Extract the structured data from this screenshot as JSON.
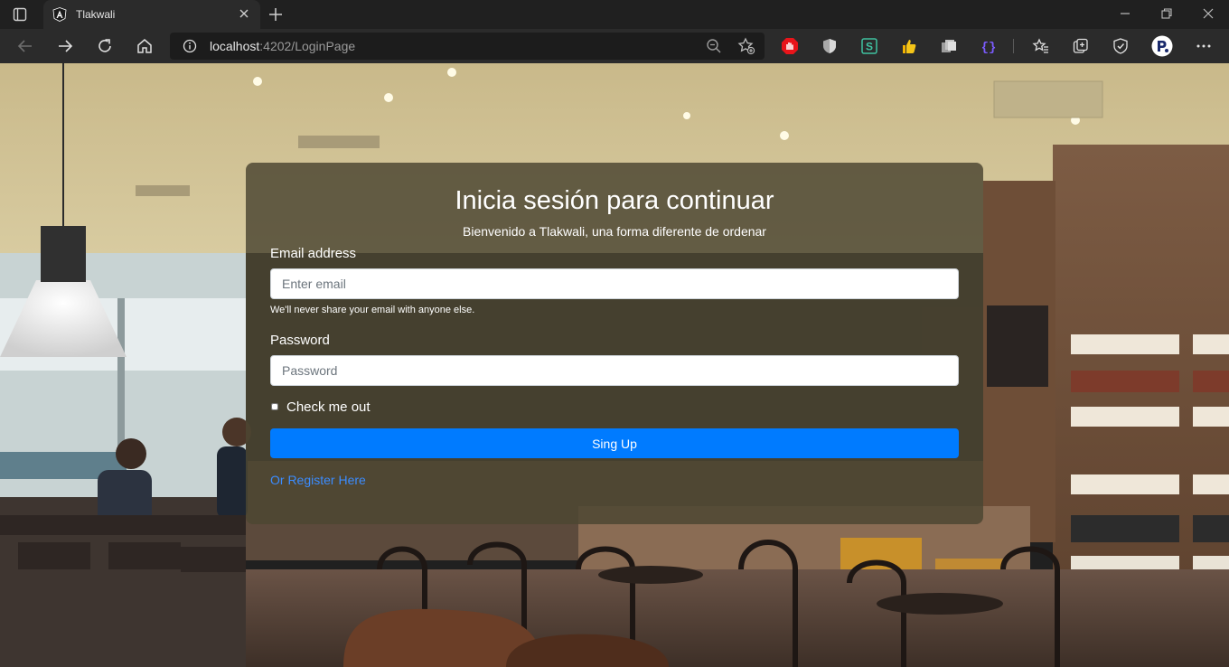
{
  "browser": {
    "tab": {
      "title": "Tlakwali",
      "favicon": "angular-icon"
    },
    "address_bar": {
      "host": "localhost",
      "rest": ":4202/LoginPage"
    },
    "extensions": [
      "adblock-icon",
      "shield-icon",
      "s-extension-icon",
      "thumbs-up-icon",
      "collections-stack-icon",
      "json-viewer-icon"
    ],
    "toolbar_icons": [
      "favorites-icon",
      "collections-icon",
      "browser-essentials-icon",
      "profile-avatar",
      "more-menu-icon"
    ]
  },
  "login": {
    "title": "Inicia sesión para continuar",
    "subtitle": "Bienvenido a Tlakwali, una forma diferente de ordenar",
    "email_label": "Email address",
    "email_placeholder": "Enter email",
    "email_help": "We'll never share your email with anyone else.",
    "password_label": "Password",
    "password_placeholder": "Password",
    "remember_label": "Check me out",
    "submit_label": "Sing Up",
    "register_link": "Or Register Here"
  },
  "colors": {
    "primary_button": "#007bff",
    "link": "#3b8cff",
    "card_overlay": "#4c4632"
  }
}
